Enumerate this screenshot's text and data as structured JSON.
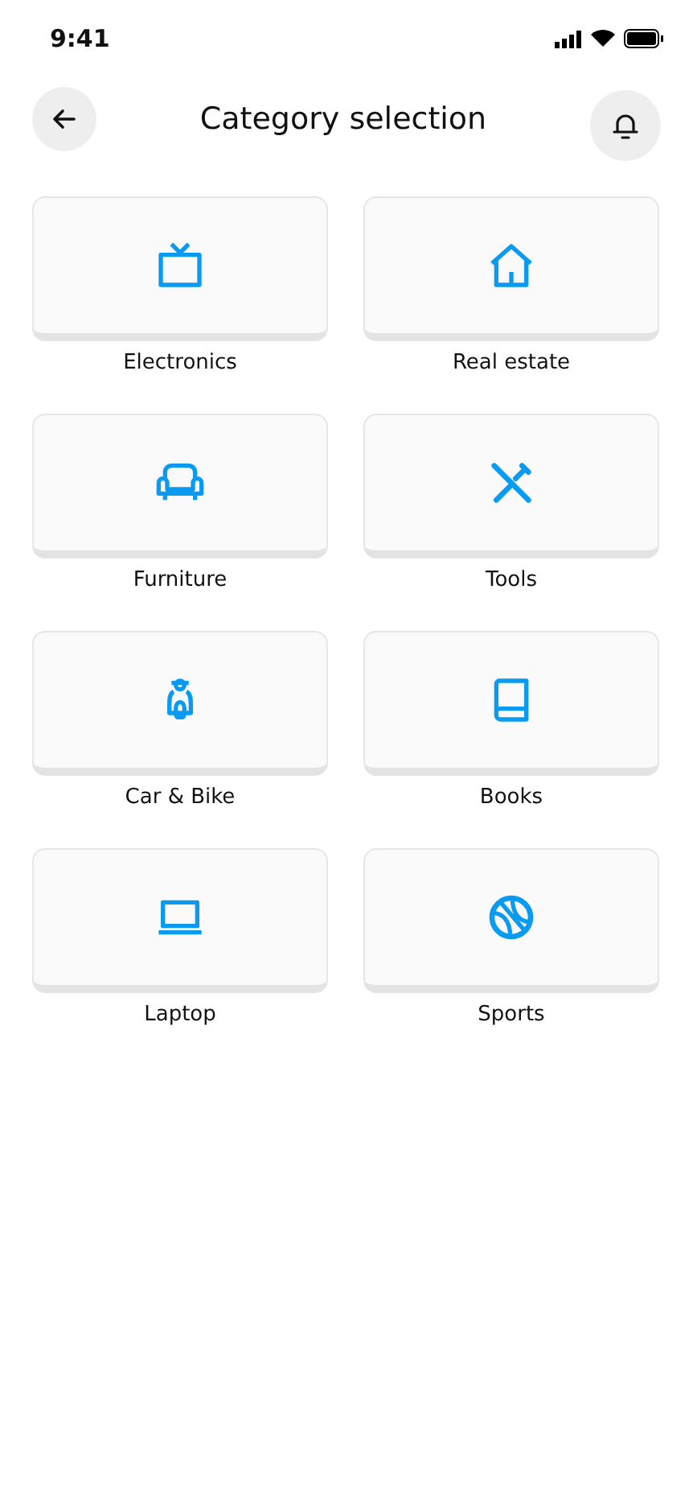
{
  "status_bar": {
    "time": "9:41"
  },
  "header": {
    "title": "Category selection"
  },
  "categories": [
    {
      "label": "Electronics"
    },
    {
      "label": "Real estate"
    },
    {
      "label": "Furniture"
    },
    {
      "label": "Tools"
    },
    {
      "label": "Car & Bike"
    },
    {
      "label": "Books"
    },
    {
      "label": "Laptop"
    },
    {
      "label": "Sports"
    }
  ]
}
